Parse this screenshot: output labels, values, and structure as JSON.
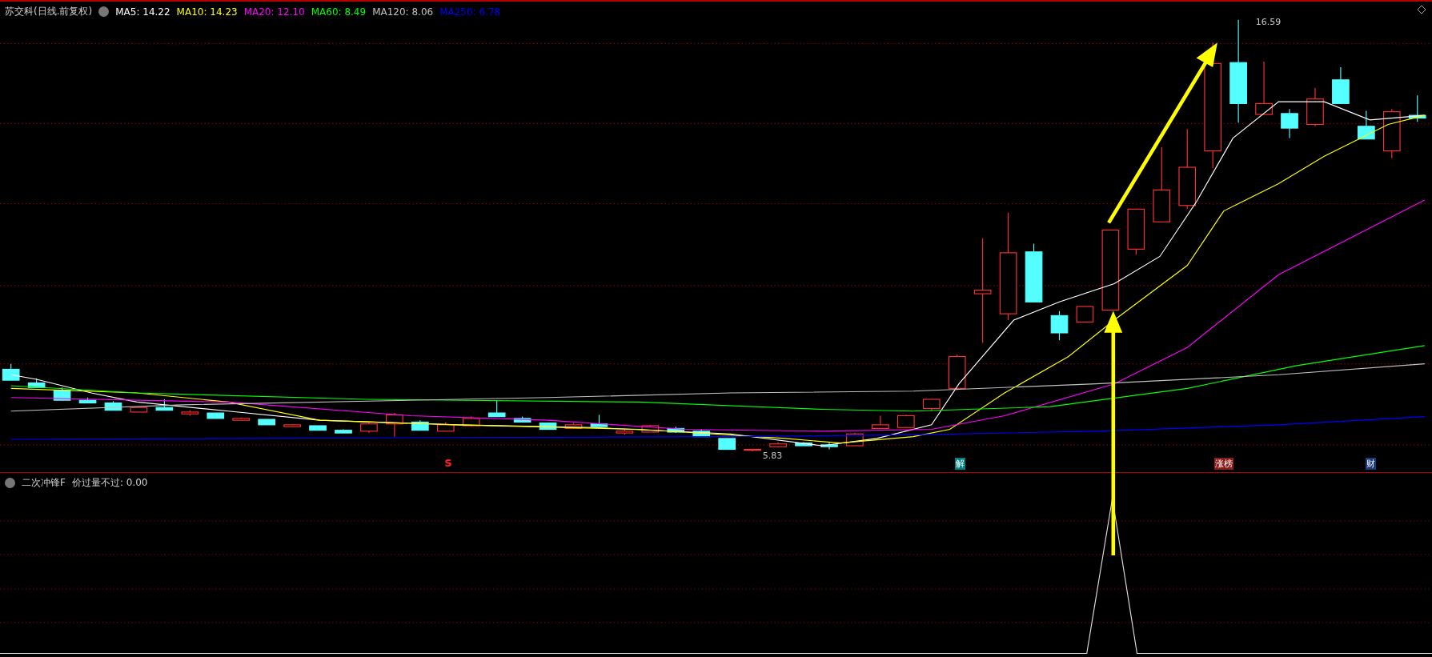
{
  "chart": {
    "title": "苏交科(日线.前复权)",
    "moving_averages": [
      {
        "label": "MA5: 14.22",
        "color": "#ffffff"
      },
      {
        "label": "MA10: 14.23",
        "color": "#ffff00"
      },
      {
        "label": "MA20: 12.10",
        "color": "#ff00ff"
      },
      {
        "label": "MA60: 8.49",
        "color": "#00ff00"
      },
      {
        "label": "MA120: 8.06",
        "color": "#c0c0c0"
      },
      {
        "label": "MA250: 6.78",
        "color": "#0000ff"
      }
    ],
    "high_label": "16.59",
    "low_label": "5.83",
    "markers": [
      {
        "text": "s",
        "kind": "letter",
        "color": "#ff2020"
      },
      {
        "text": "解",
        "kind": "badge",
        "color": "#008080"
      },
      {
        "text": "涨榜",
        "kind": "badge",
        "color": "#8b1a1a"
      },
      {
        "text": "财",
        "kind": "badge",
        "color": "#1a3a7a"
      }
    ]
  },
  "indicator": {
    "title": "二次冲锋F",
    "reading": "价过量不过: 0.00"
  }
}
